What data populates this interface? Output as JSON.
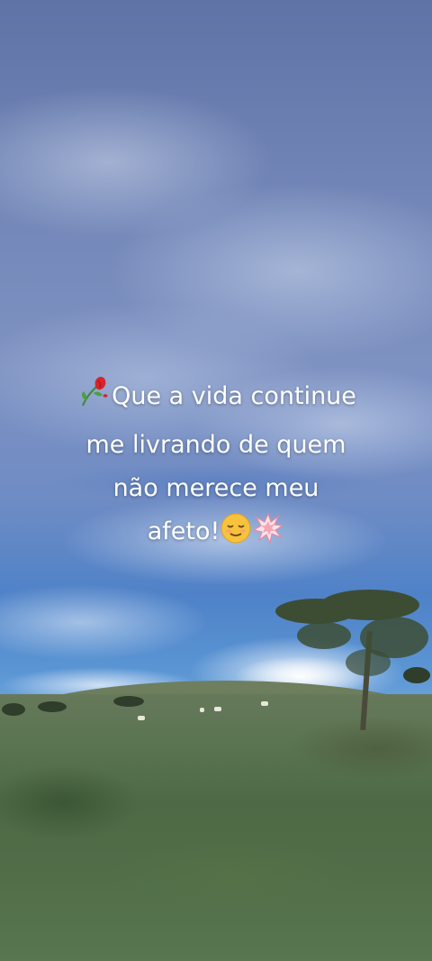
{
  "caption": {
    "line1_text": "Que a vida continue",
    "line2": "me livrando de quem",
    "line3": "não merece meu",
    "line4_text": "afeto!",
    "leading_emoji": "wilted-rose-emoji",
    "trailing_emojis": [
      "relieved-face-emoji",
      "anger-symbol-emoji"
    ]
  },
  "background": {
    "scene": "cloudy-sky-over-grass-field",
    "sky_color": "#7387b8",
    "lower_sky_color": "#5b96d4",
    "grass_color": "#4d6a45",
    "text_color": "#ffffff"
  }
}
